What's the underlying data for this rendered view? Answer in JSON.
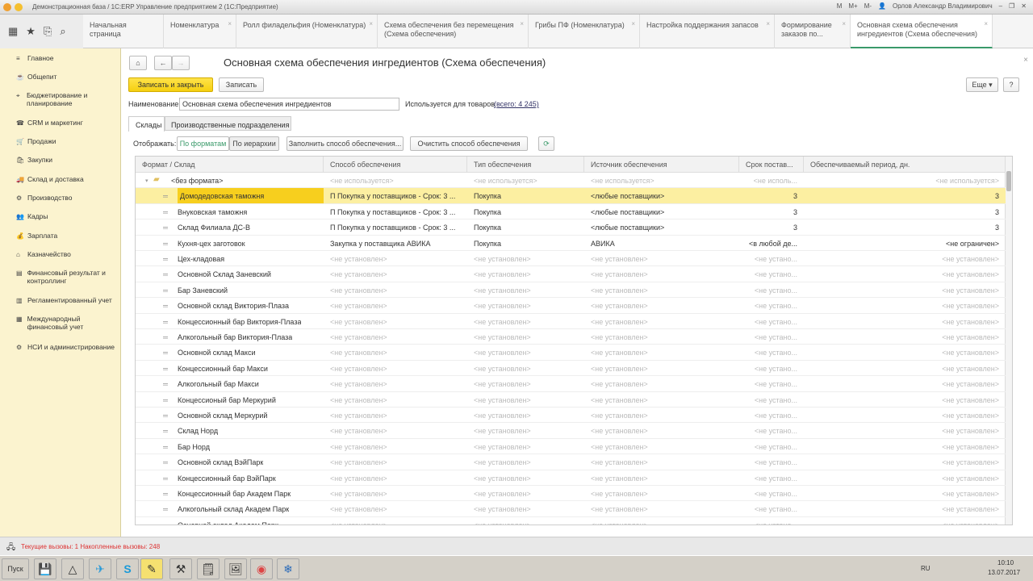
{
  "window": {
    "title": "Демонстрационная база / 1С:ERP Управление предприятием 2  (1С:Предприятие)",
    "user": "Орлов Александр Владимирович",
    "memo_buttons": [
      "M",
      "M+",
      "M-"
    ]
  },
  "tabs": [
    {
      "label": "Начальная страница"
    },
    {
      "label": "Номенклатура"
    },
    {
      "label": "Ролл филадельфия (Номенклатура)"
    },
    {
      "label": "Схема обеспечения без перемещения (Схема обеспечения)"
    },
    {
      "label": "Грибы ПФ (Номенклатура)"
    },
    {
      "label": "Настройка поддержания запасов"
    },
    {
      "label": "Формирование заказов по..."
    },
    {
      "label": "Основная схема обеспечения ингредиентов (Схема обеспечения)",
      "active": true
    }
  ],
  "sidebar": {
    "items": [
      {
        "label": "Главное",
        "icon": "menu-icon"
      },
      {
        "label": "Общепит",
        "icon": "food-icon"
      },
      {
        "label": "Бюджетирование и планирование",
        "icon": "budget-icon"
      },
      {
        "label": "CRM и маркетинг",
        "icon": "crm-icon"
      },
      {
        "label": "Продажи",
        "icon": "sales-icon"
      },
      {
        "label": "Закупки",
        "icon": "purchase-icon"
      },
      {
        "label": "Склад и доставка",
        "icon": "warehouse-icon"
      },
      {
        "label": "Производство",
        "icon": "production-icon"
      },
      {
        "label": "Кадры",
        "icon": "staff-icon"
      },
      {
        "label": "Зарплата",
        "icon": "salary-icon"
      },
      {
        "label": "Казначейство",
        "icon": "treasury-icon"
      },
      {
        "label": "Финансовый результат и контроллинг",
        "icon": "finance-icon"
      },
      {
        "label": "Регламентированный учет",
        "icon": "accounting-icon"
      },
      {
        "label": "Международный финансовый учет",
        "icon": "intl-icon"
      },
      {
        "label": "НСИ и администрирование",
        "icon": "settings-icon"
      }
    ]
  },
  "form": {
    "title": "Основная схема обеспечения ингредиентов (Схема обеспечения)",
    "save_close": "Записать и закрыть",
    "save": "Записать",
    "more": "Еще",
    "help": "?",
    "name_label": "Наименование:",
    "name_value": "Основная схема обеспечения ингредиентов",
    "used_for": "Используется для товаров",
    "used_link": "(всего: 4 245)",
    "tabs": [
      "Склады",
      "Производственные подразделения"
    ],
    "show_label": "Отображать:",
    "by_formats": "По форматам",
    "by_hierarchy": "По иерархии",
    "fill": "Заполнить способ обеспечения...",
    "clear": "Очистить способ обеспечения"
  },
  "table": {
    "columns": [
      "Формат / Склад",
      "Способ обеспечения",
      "Тип обеспечения",
      "Источник обеспечения",
      "Срок постав...",
      "Обеспечиваемый период, дн."
    ],
    "group": {
      "name": "<без формата>",
      "c1": "<не используется>",
      "c2": "<не используется>",
      "c3": "<не используется>",
      "c4": "<не исполь...",
      "c5": "<не используется>"
    },
    "rows": [
      {
        "name": "Домодедовская таможня",
        "c1": "П Покупка у поставщиков - Срок: 3 ...",
        "c2": "Покупка",
        "c3": "<любые поставщики>",
        "c4": "3",
        "c5": "3",
        "selected": true
      },
      {
        "name": "Внуковская таможня",
        "c1": "П Покупка у поставщиков - Срок: 3 ...",
        "c2": "Покупка",
        "c3": "<любые поставщики>",
        "c4": "3",
        "c5": "3"
      },
      {
        "name": "Склад Филиала ДС-В",
        "c1": "П Покупка у поставщиков - Срок: 3 ...",
        "c2": "Покупка",
        "c3": "<любые поставщики>",
        "c4": "3",
        "c5": "3"
      },
      {
        "name": "Кухня-цех заготовок",
        "c1": "Закупка у поставщика АВИКА",
        "c2": "Покупка",
        "c3": "АВИКА",
        "c4": "<в любой де...",
        "c5": "<не ограничен>"
      },
      {
        "name": "Цех-кладовая"
      },
      {
        "name": "Основной Склад Заневский"
      },
      {
        "name": "Бар Заневский"
      },
      {
        "name": "Основной склад Виктория-Плаза"
      },
      {
        "name": "Концессионный бар Виктория-Плаза"
      },
      {
        "name": "Алкогольный бар Виктория-Плаза"
      },
      {
        "name": "Основной склад Макси"
      },
      {
        "name": "Концессионный бар Макси"
      },
      {
        "name": "Алкогольный бар Макси"
      },
      {
        "name": "Концессионый бар Меркурий"
      },
      {
        "name": "Основной склад Меркурий"
      },
      {
        "name": "Склад Норд"
      },
      {
        "name": "Бар Норд"
      },
      {
        "name": "Основной склад ВэйПарк"
      },
      {
        "name": "Концессионный бар ВэйПарк"
      },
      {
        "name": "Концессионный бар Академ Парк"
      },
      {
        "name": "Алкогольный склад Академ Парк"
      },
      {
        "name": "Основной склад Академ Парк"
      }
    ],
    "not_set": "<не установлен>",
    "not_set_short": "<не устано..."
  },
  "status": {
    "text": "Текущие вызовы: 1   Накопленные вызовы: 248"
  },
  "taskbar": {
    "start": "Пуск",
    "lang": "RU",
    "time": "10:10",
    "date": "13.07.2017"
  }
}
